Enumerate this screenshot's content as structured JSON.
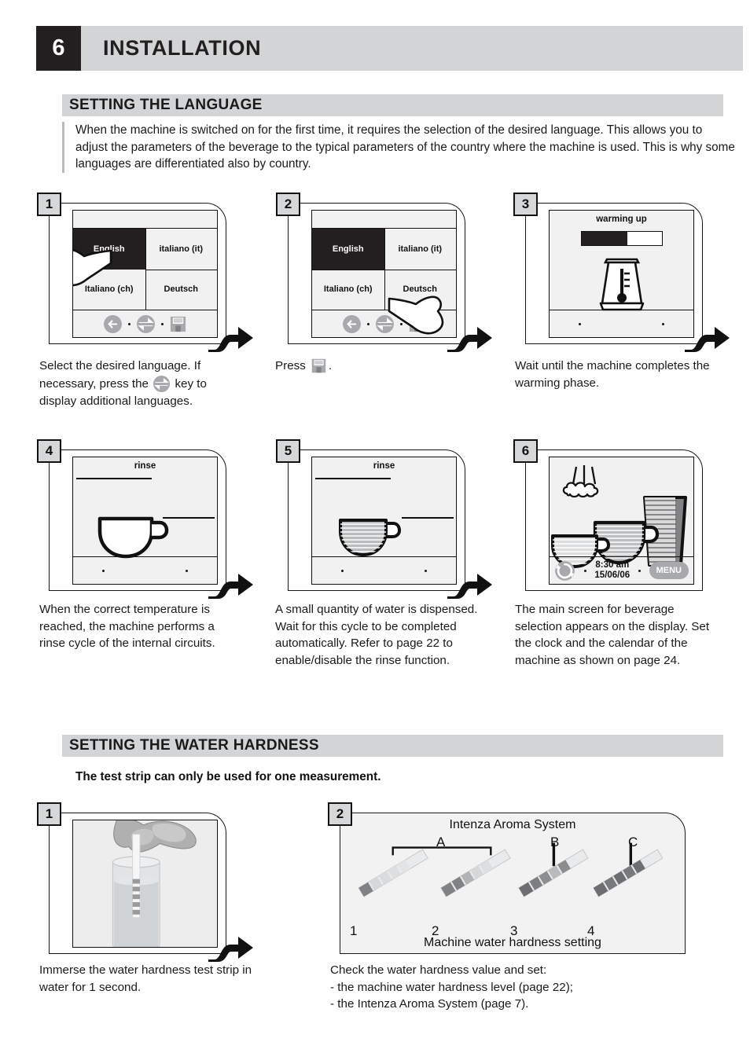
{
  "header": {
    "number": "6",
    "title": "INSTALLATION"
  },
  "sections": [
    {
      "id": "language",
      "title": "SETTING THE LANGUAGE"
    },
    {
      "id": "hardness",
      "title": "SETTING THE WATER HARDNESS"
    }
  ],
  "intro": "When the machine is switched on for the first time, it requires the selection of the desired language. This allows you to adjust the parameters of the beverage to the typical parameters of the country where the machine is used. This is why some languages are differentiated also by country.",
  "hardness_note": "The test strip can only be used for one measurement.",
  "language_steps": [
    {
      "number": "1",
      "screen_type": "language-list",
      "languages": [
        "English",
        "italiano (it)",
        "Italiano (ch)",
        "Deutsch"
      ],
      "selected_index": 0,
      "icons": [
        "back-arrow-icon",
        "up-down-arrow-icon",
        "save-floppy-icon"
      ],
      "hand_target": "selected-language-cell",
      "caption": "Select the desired language. If necessary, press the     key to display additional languages."
    },
    {
      "number": "2",
      "screen_type": "language-list",
      "languages": [
        "English",
        "italiano (it)",
        "Italiano (ch)",
        "Deutsch"
      ],
      "selected_index": 0,
      "icons": [
        "back-arrow-icon",
        "up-down-arrow-icon",
        "save-floppy-icon"
      ],
      "hand_target": "save-floppy-icon",
      "caption": "Press     ."
    },
    {
      "number": "3",
      "screen_type": "warming-up",
      "screen_title": "warming up",
      "progress_percent": 57,
      "graphic": "boiler-thermometer-icon",
      "caption": "Wait until the machine completes the warming phase."
    },
    {
      "number": "4",
      "screen_type": "rinse-empty-cup",
      "screen_title": "rinse",
      "graphic": "empty-cup-icon",
      "caption": "When the correct temperature is reached, the machine performs a rinse cycle of the internal circuits."
    },
    {
      "number": "5",
      "screen_type": "rinse-full-cup",
      "screen_title": "rinse",
      "graphic": "filled-cup-icon",
      "caption": "A small quantity of water is dispensed. Wait for this cycle to be completed automatically. Refer to page 22 to enable/disable the rinse function."
    },
    {
      "number": "6",
      "screen_type": "main-beverage-screen",
      "graphic": "three-cups-with-steam",
      "clock_time": "8:30 am",
      "clock_date": "15/06/06",
      "menu_label": "MENU",
      "icons": [
        "rinse-cycle-icon",
        "menu-button"
      ],
      "caption": "The main screen for beverage selection appears on the display. Set the clock and the calendar of the machine as shown on page 24."
    }
  ],
  "hardness_steps": [
    {
      "number": "1",
      "content_type": "photo",
      "photo_description": "hand-dipping-test-strip-in-glass-of-water",
      "caption": "Immerse the water hardness test strip in water for 1 second."
    },
    {
      "number": "2",
      "content_type": "intenza-chart",
      "caption_intro": "Check the water hardness value and set:",
      "caption_items": [
        "-  the machine water hardness level (page 22);",
        "-  the Intenza Aroma System (page 7)."
      ]
    }
  ],
  "intenza_chart": {
    "title": "Intenza Aroma System",
    "bottom_label": "Machine water hardness setting",
    "group_labels": [
      "A",
      "B",
      "C"
    ],
    "setting_numbers": [
      "1",
      "2",
      "3",
      "4"
    ],
    "strips": [
      {
        "setting": "1",
        "dark_segments": 1
      },
      {
        "setting": "2",
        "dark_segments": 2
      },
      {
        "setting": "3",
        "dark_segments": 3
      },
      {
        "setting": "4",
        "dark_segments": 4
      }
    ]
  },
  "colors": {
    "header_bar": "#d2d4d6",
    "header_number_bg": "#231f20",
    "selected_cell": "#231f20",
    "panel_border": "#1a1a1a",
    "screen_bg": "#f1f1f1",
    "icon_gray": "#a7a9ac"
  }
}
